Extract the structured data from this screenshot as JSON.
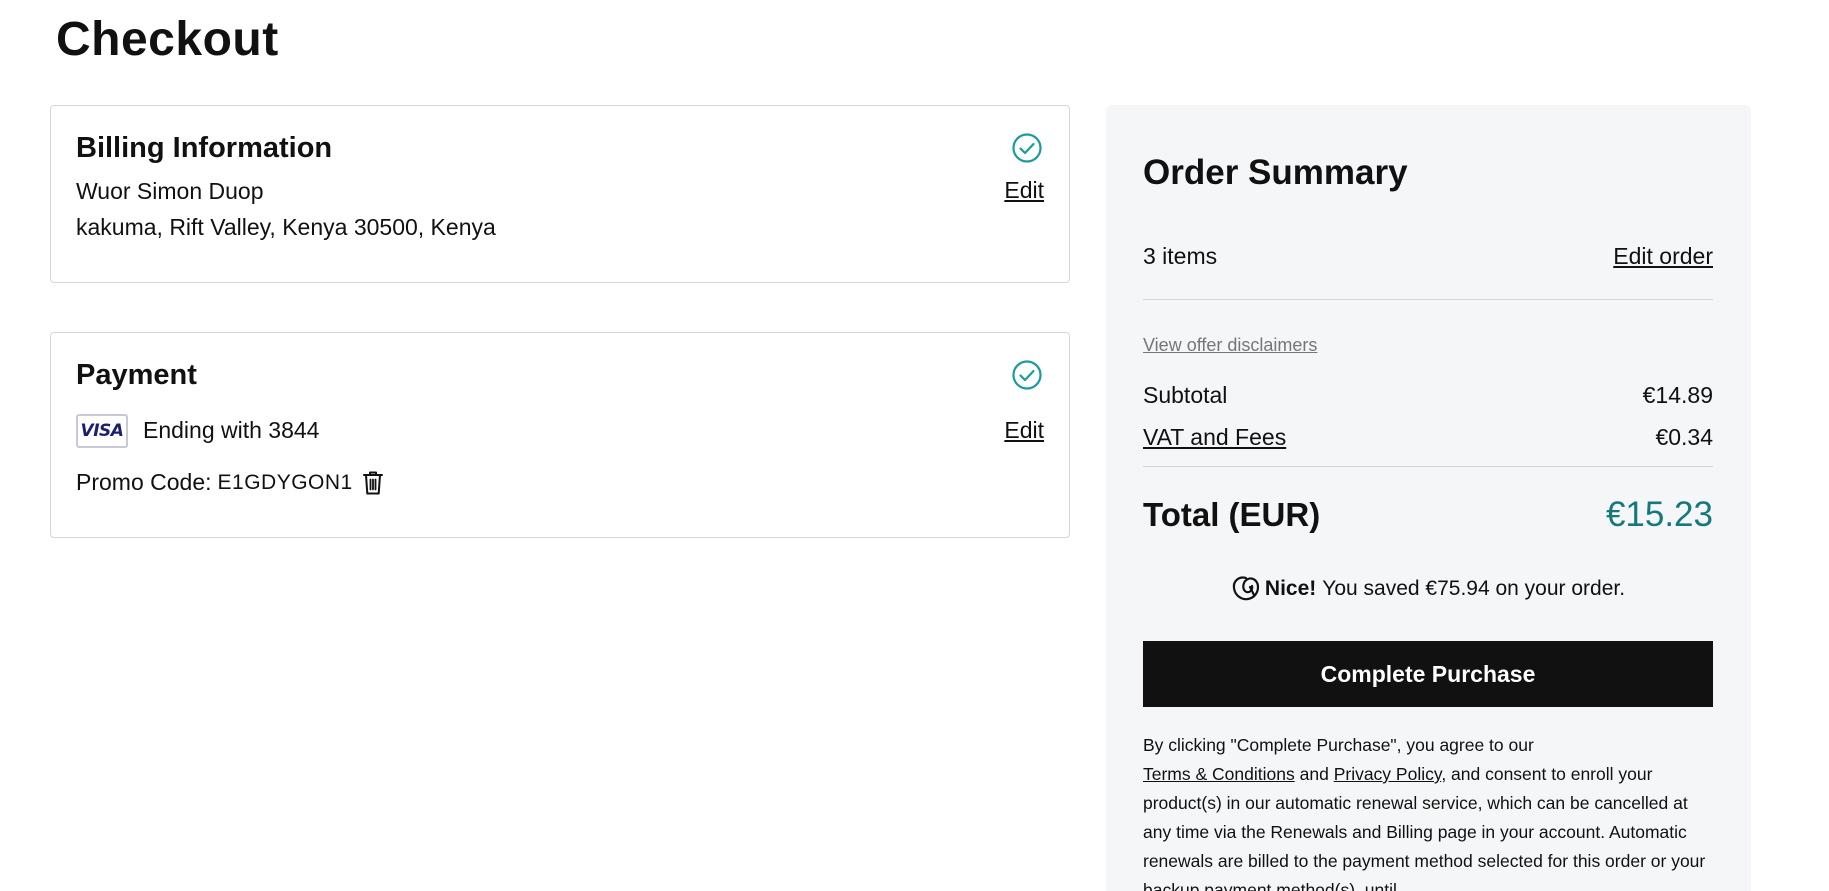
{
  "page": {
    "title": "Checkout"
  },
  "billing": {
    "title": "Billing Information",
    "name": "Wuor Simon Duop",
    "address": "kakuma, Rift Valley, Kenya 30500, Kenya",
    "edit_label": "Edit",
    "status_icon": "check-circle-icon"
  },
  "payment": {
    "title": "Payment",
    "card_brand": "VISA",
    "card_text": "Ending with 3844",
    "edit_label": "Edit",
    "promo_label": "Promo Code:",
    "promo_code": "E1GDYGON1",
    "status_icon": "check-circle-icon",
    "remove_icon": "trash-icon"
  },
  "summary": {
    "title": "Order Summary",
    "items_count": "3 items",
    "edit_order_label": "Edit order",
    "disclaimers_label": "View offer disclaimers",
    "subtotal_label": "Subtotal",
    "subtotal_value": "€14.89",
    "vat_label": "VAT and Fees",
    "vat_value": "€0.34",
    "total_label": "Total (EUR)",
    "total_value": "€15.23",
    "savings_prefix": "Nice!",
    "savings_text": "You saved €75.94 on your order.",
    "purchase_label": "Complete Purchase",
    "legal_1": "By clicking \"Complete Purchase\", you agree to our",
    "terms_label": "Terms & Conditions",
    "legal_and": "and",
    "privacy_label": "Privacy Policy",
    "legal_2": ", and consent to enroll your product(s) in our automatic renewal service, which can be cancelled at any time via the Renewals and Billing page in your account. Automatic renewals are billed to the payment method selected for this order or your backup payment method(s), until"
  },
  "colors": {
    "accent_teal": "#16787d",
    "check_teal": "#1a9c9c",
    "button_black": "#111111",
    "summary_bg": "#f5f6f7"
  }
}
